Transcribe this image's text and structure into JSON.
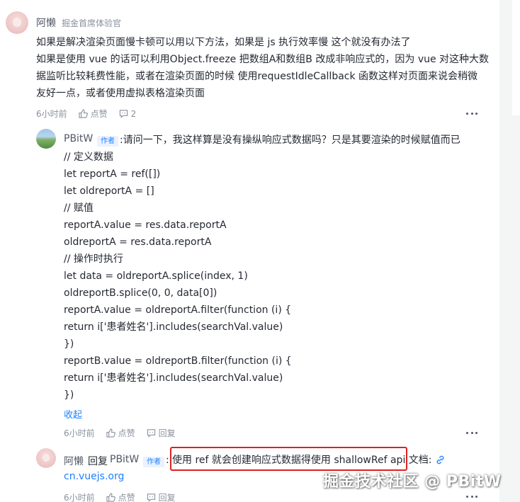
{
  "comment": {
    "author": "阿懒",
    "title": "掘金首席体验官",
    "lines": [
      "如果是解决渲染页面慢卡顿可以用以下方法，如果是 js 执行效率慢 这个就没有办法了",
      "如果是使用 vue 的话可以利用Object.freeze 把数组A和数组B 改成非响应式的，因为 vue 对这种大数",
      "据监听比较耗费性能，或者在渲染页面的时候 使用requestIdleCallback 函数这样对页面来说会稍微",
      "友好一点，或者使用虚拟表格渲染页面"
    ],
    "time": "6小时前",
    "like": "点赞",
    "reply_count": "2"
  },
  "reply1": {
    "author": "PBitW",
    "tag": "作者",
    "lines": [
      ":请问一下，我这样算是没有操纵响应式数据吗？只是其要渲染的时候赋值而已",
      "// 定义数据",
      "let reportA = ref([])",
      "let oldreportA = []",
      "// 赋值",
      "reportA.value = res.data.reportA",
      "oldreportA = res.data.reportA",
      "// 操作时执行",
      "let data = oldreportA.splice(index, 1)",
      "oldreportB.splice(0, 0, data[0])",
      "reportA.value = oldreportA.filter(function (i) {",
      "return i['患者姓名'].includes(searchVal.value)",
      "})",
      "reportB.value = oldreportB.filter(function (i) {",
      "return i['患者姓名'].includes(searchVal.value)",
      "})"
    ],
    "collapse": "收起",
    "time": "6小时前",
    "like": "点赞",
    "reply": "回复"
  },
  "reply2": {
    "author": "阿懒",
    "reply_word": "回复",
    "target": "PBitW",
    "tag": "作者",
    "colon": ":",
    "text": "使用 ref 就会创建响应式数据得使用 shallowRef api 文档:",
    "link": "cn.vuejs.org",
    "time": "6小时前",
    "like": "点赞",
    "reply": "回复"
  },
  "watermark": "掘金技术社区 @ PBitW",
  "colors": {
    "accent": "#1e80ff",
    "highlight": "#e02020"
  }
}
